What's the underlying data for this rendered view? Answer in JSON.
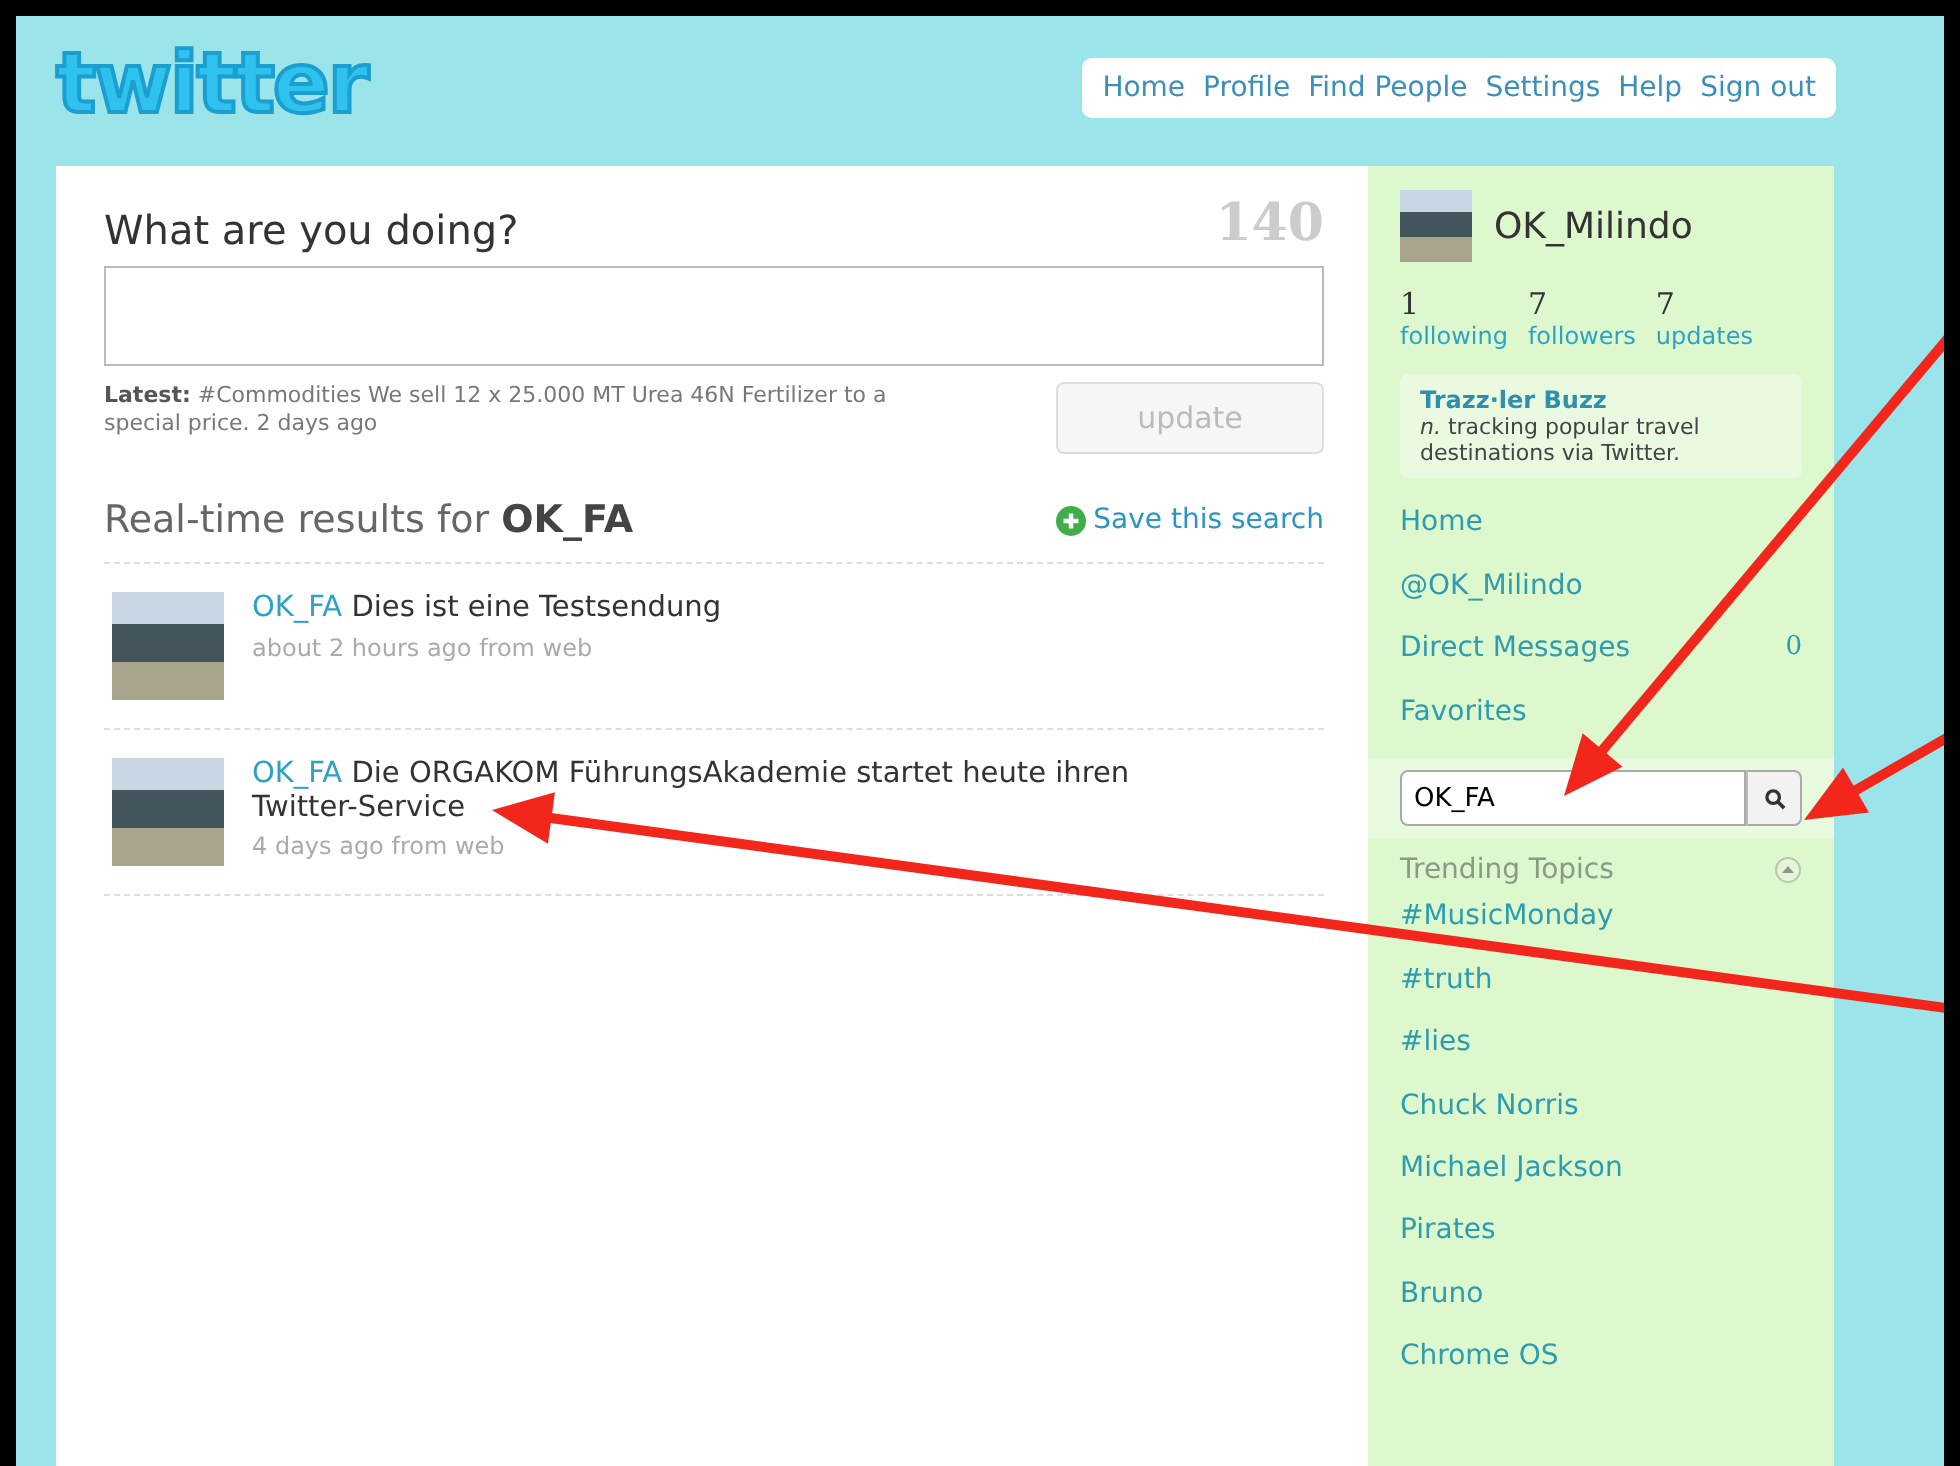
{
  "logo": "twitter",
  "nav": [
    "Home",
    "Profile",
    "Find People",
    "Settings",
    "Help",
    "Sign out"
  ],
  "composer": {
    "prompt": "What are you doing?",
    "counter": "140",
    "latest_label": "Latest:",
    "latest_text": "#Commodities We sell 12 x 25.000 MT Urea 46N Fertilizer to a special price. 2 days ago",
    "button": "update",
    "button_disabled": true
  },
  "results": {
    "heading": "Real-time results for",
    "query": "OK_FA",
    "save_label": "Save this search"
  },
  "tweets": [
    {
      "user": "OK_FA",
      "text": "Dies ist eine Testsendung",
      "meta": "about 2 hours ago from web"
    },
    {
      "user": "OK_FA",
      "text": "Die ORGAKOM FührungsAkademie startet heute ihren Twitter-Service",
      "meta": "4 days ago from web"
    }
  ],
  "sidebar": {
    "username": "OK_Milindo",
    "stats": [
      {
        "count": "1",
        "label": "following"
      },
      {
        "count": "7",
        "label": "followers"
      },
      {
        "count": "7",
        "label": "updates"
      }
    ],
    "promo": {
      "title": "Trazz·ler Buzz",
      "abbr": "n.",
      "text": "tracking popular travel destinations via Twitter."
    },
    "menu": [
      {
        "label": "Home"
      },
      {
        "label": "@OK_Milindo"
      },
      {
        "label": "Direct Messages",
        "count": "0"
      },
      {
        "label": "Favorites"
      }
    ],
    "search": {
      "value": "OK_FA"
    },
    "trending_title": "Trending Topics",
    "trending_expanded": true,
    "trending": [
      "#MusicMonday",
      "#truth",
      "#lies",
      "Chuck Norris",
      "Michael Jackson",
      "Pirates",
      "Bruno",
      "Chrome OS"
    ]
  },
  "annotations": [
    {
      "kind": "arrow"
    },
    {
      "kind": "arrow"
    },
    {
      "kind": "arrow"
    }
  ]
}
